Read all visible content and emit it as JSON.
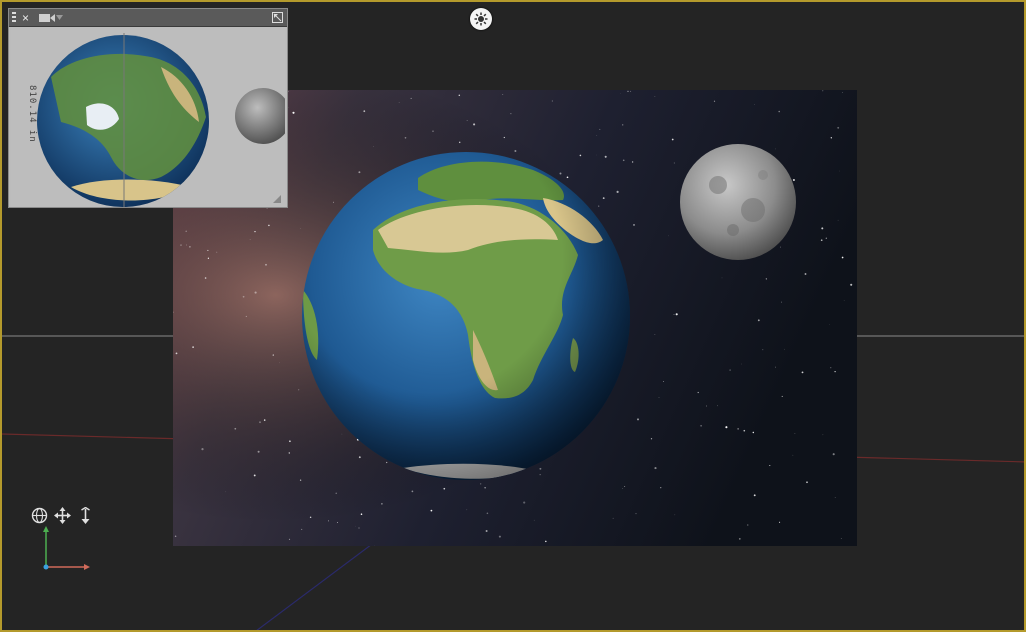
{
  "viewport": {
    "border_color": "#b49a2c",
    "background": "#242424",
    "top_tool_icon": "render-settings-icon"
  },
  "mini_panel": {
    "toolbar": {
      "menu_icon": "panel-menu-icon",
      "close_label": "×",
      "camera_icon": "camera-icon",
      "dropdown_icon": "chevron-down-icon",
      "maximize_icon": "maximize-icon"
    },
    "distance_readout": "810.14 in",
    "resize_icon": "resize-grip-icon"
  },
  "nav_controls": [
    {
      "name": "orbit",
      "icon": "orbit-icon"
    },
    {
      "name": "pan",
      "icon": "pan-icon"
    },
    {
      "name": "dolly",
      "icon": "dolly-icon"
    }
  ],
  "axis_colors": {
    "x": "#d06a5a",
    "y": "#4caf50",
    "origin": "#3aa0e0"
  },
  "scene": {
    "objects": [
      "earth",
      "moon",
      "starfield-background"
    ]
  }
}
